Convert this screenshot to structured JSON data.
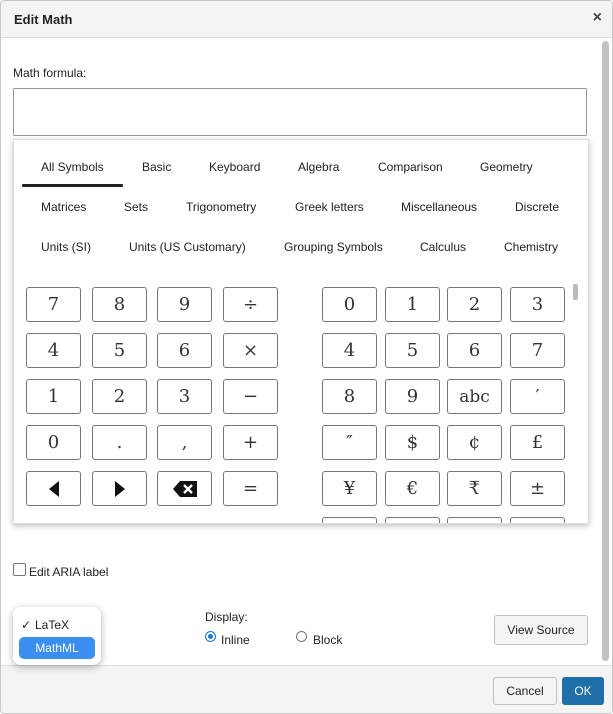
{
  "dialog": {
    "title": "Edit Math",
    "close_label": "×"
  },
  "formula": {
    "label": "Math formula:",
    "value": ""
  },
  "palette": {
    "tabs_row1": [
      "All Symbols",
      "Basic",
      "Keyboard",
      "Algebra",
      "Comparison",
      "Geometry"
    ],
    "tabs_row2": [
      "Matrices",
      "Sets",
      "Trigonometry",
      "Greek letters",
      "Miscellaneous",
      "Discrete"
    ],
    "tabs_row3": [
      "Units (SI)",
      "Units (US Customary)",
      "Grouping Symbols",
      "Calculus",
      "Chemistry"
    ],
    "active_tab": "All Symbols",
    "left_keys": [
      "7",
      "8",
      "9",
      "÷",
      "4",
      "5",
      "6",
      "×",
      "1",
      "2",
      "3",
      "−",
      "0",
      ".",
      ",",
      "+",
      "◀",
      "▶",
      "⌫",
      "="
    ],
    "right_keys": [
      "0",
      "1",
      "2",
      "3",
      "4",
      "5",
      "6",
      "7",
      "8",
      "9",
      "abc",
      "′",
      "″",
      "$",
      "¢",
      "£",
      "¥",
      "€",
      "₹",
      "±"
    ]
  },
  "aria": {
    "label": "Edit ARIA label"
  },
  "display": {
    "label": "Display:",
    "inline_label": "Inline",
    "block_label": "Block",
    "selected": "Inline"
  },
  "popup": {
    "items": [
      "LaTeX",
      "MathML"
    ],
    "checked": "LaTeX",
    "highlighted": "MathML",
    "check_mark": "✓"
  },
  "buttons": {
    "view_source": "View Source",
    "cancel": "Cancel",
    "ok": "OK"
  },
  "colors": {
    "primary": "#1f6fa8",
    "highlight": "#3b8ff0"
  },
  "icons": {
    "close": "close-icon",
    "left": "left-arrow-icon",
    "right": "right-arrow-icon",
    "backspace": "backspace-icon"
  }
}
